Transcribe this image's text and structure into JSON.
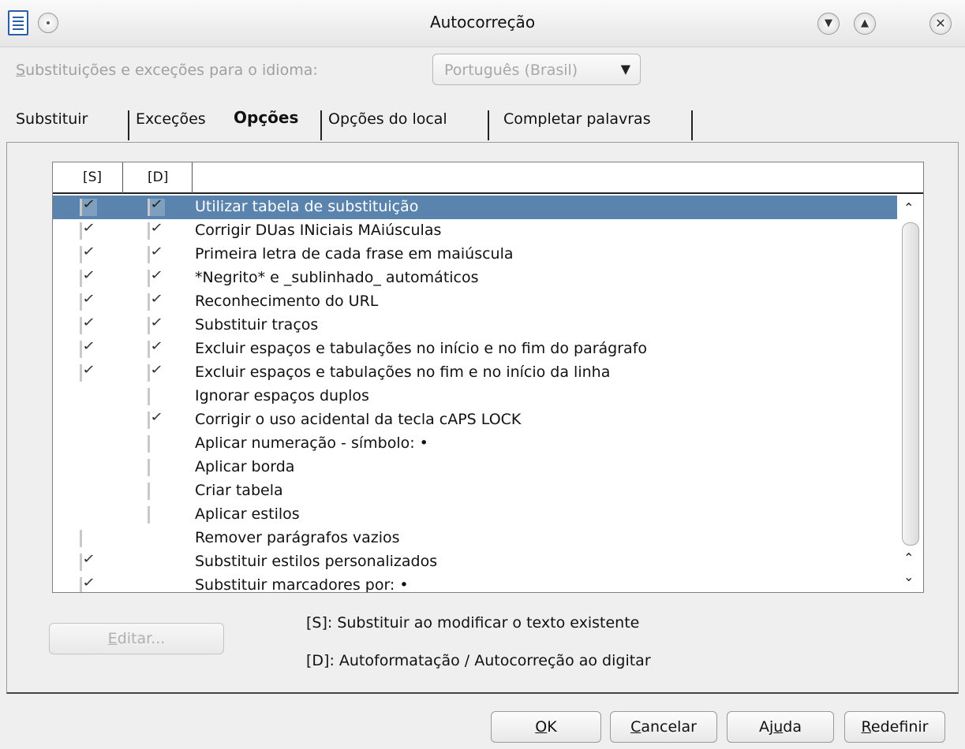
{
  "window": {
    "title": "Autocorreção",
    "buttons": [
      "chevron-down",
      "chevron-up",
      "close"
    ]
  },
  "language": {
    "label_first": "S",
    "label_rest": "ubstituições e exceções para o idioma:",
    "selected": "Português (Brasil)"
  },
  "tabs": [
    {
      "label": "Substituir"
    },
    {
      "label": "Exceções"
    },
    {
      "label": "Opções",
      "active": true
    },
    {
      "label": "Opções do local"
    },
    {
      "label": "Completar palavras"
    }
  ],
  "list": {
    "col_s": "[S]",
    "col_d": "[D]",
    "rows": [
      {
        "label": "Utilizar tabela de substituição",
        "s": true,
        "d": true,
        "selected": true
      },
      {
        "label": "Corrigir DUas INiciais MAiúsculas",
        "s": true,
        "d": true
      },
      {
        "label": "Primeira letra de cada frase em maiúscula",
        "s": true,
        "d": true
      },
      {
        "label": "*Negrito* e _sublinhado_ automáticos",
        "s": true,
        "d": true
      },
      {
        "label": "Reconhecimento do URL",
        "s": true,
        "d": true
      },
      {
        "label": "Substituir traços",
        "s": true,
        "d": true
      },
      {
        "label": "Excluir espaços e tabulações no início e no fim do parágrafo",
        "s": true,
        "d": true
      },
      {
        "label": "Excluir espaços e tabulações no fim e no início da linha",
        "s": true,
        "d": true
      },
      {
        "label": "Ignorar espaços duplos",
        "s": null,
        "d": false
      },
      {
        "label": "Corrigir o uso acidental da tecla cAPS LOCK",
        "s": null,
        "d": true
      },
      {
        "label": "Aplicar numeração - símbolo: •",
        "s": null,
        "d": false
      },
      {
        "label": "Aplicar borda",
        "s": null,
        "d": false
      },
      {
        "label": "Criar tabela",
        "s": null,
        "d": false
      },
      {
        "label": "Aplicar estilos",
        "s": null,
        "d": false
      },
      {
        "label": "Remover parágrafos vazios",
        "s": false,
        "d": null
      },
      {
        "label": "Substituir estilos personalizados",
        "s": true,
        "d": null
      },
      {
        "label": "Substituir marcadores por: •",
        "s": true,
        "d": null
      }
    ]
  },
  "edit_button": {
    "first": "E",
    "rest": "ditar..."
  },
  "legend": {
    "s": "[S]: Substituir ao modificar o texto existente",
    "d": "[D]: Autoformatação / Autocorreção ao digitar"
  },
  "buttons": {
    "ok": {
      "first": "O",
      "rest": "K"
    },
    "cancel": {
      "first": "C",
      "rest": "ancelar"
    },
    "help": {
      "pre": "Aj",
      "ul": "u",
      "post": "da"
    },
    "reset": {
      "first": "R",
      "rest": "edefinir"
    }
  }
}
